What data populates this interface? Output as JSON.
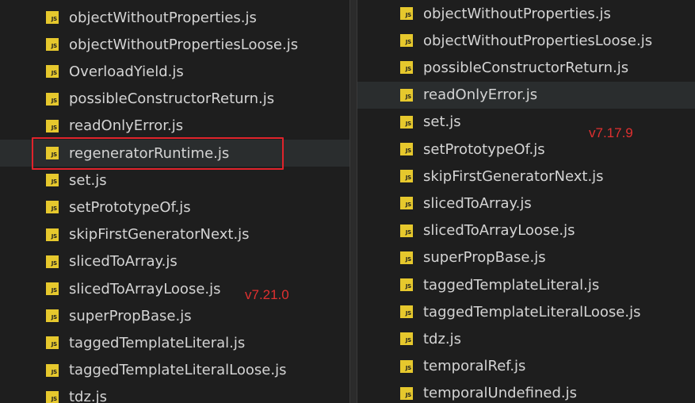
{
  "left_panel": {
    "files": [
      "objectWithoutProperties.js",
      "objectWithoutPropertiesLoose.js",
      "OverloadYield.js",
      "possibleConstructorReturn.js",
      "readOnlyError.js",
      "regeneratorRuntime.js",
      "set.js",
      "setPrototypeOf.js",
      "skipFirstGeneratorNext.js",
      "slicedToArray.js",
      "slicedToArrayLoose.js",
      "superPropBase.js",
      "taggedTemplateLiteral.js",
      "taggedTemplateLiteralLoose.js",
      "tdz.js"
    ],
    "version_label": "v7.21.0",
    "highlighted_file": "regeneratorRuntime.js"
  },
  "right_panel": {
    "files": [
      "objectWithoutProperties.js",
      "objectWithoutPropertiesLoose.js",
      "possibleConstructorReturn.js",
      "readOnlyError.js",
      "set.js",
      "setPrototypeOf.js",
      "skipFirstGeneratorNext.js",
      "slicedToArray.js",
      "slicedToArrayLoose.js",
      "superPropBase.js",
      "taggedTemplateLiteral.js",
      "taggedTemplateLiteralLoose.js",
      "tdz.js",
      "temporalRef.js",
      "temporalUndefined.js"
    ],
    "version_label": "v7.17.9"
  },
  "icon": {
    "name": "js-file-icon",
    "text": "JS",
    "color": "#e6c82d"
  },
  "colors": {
    "background": "#1e1e1e",
    "text": "#d4d4d4",
    "annotation": "#e03030"
  }
}
